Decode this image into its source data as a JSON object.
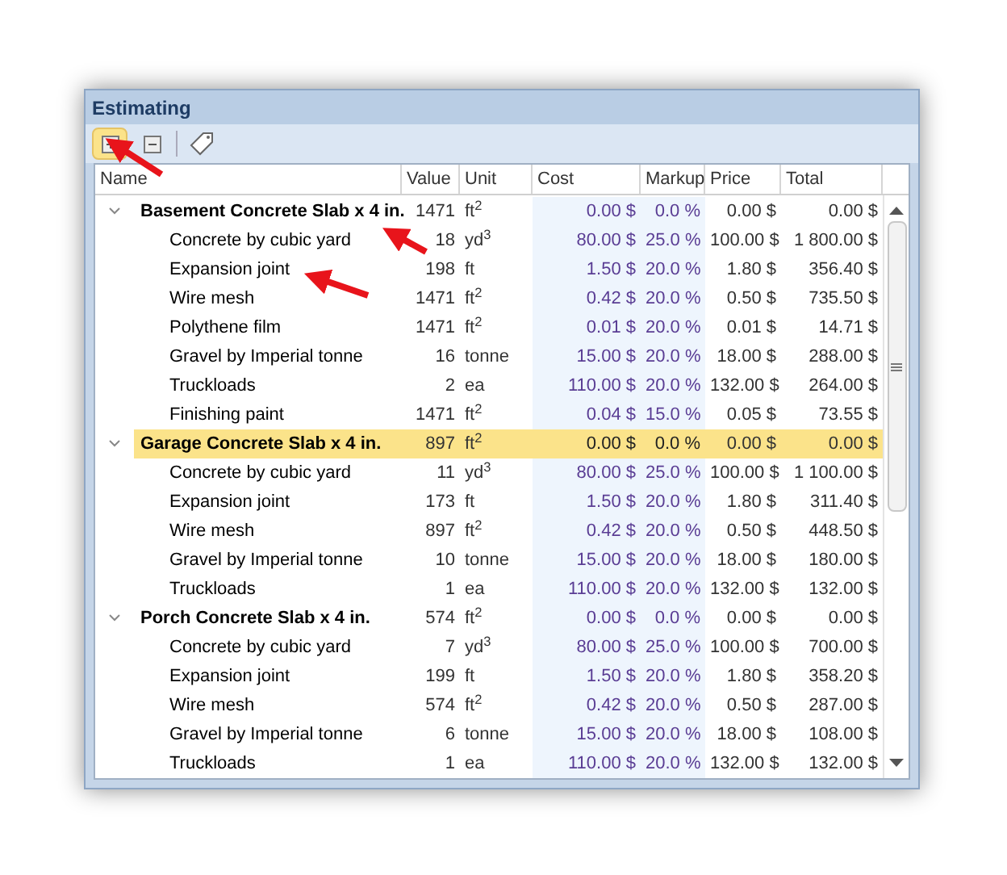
{
  "window": {
    "title": "Estimating"
  },
  "toolbar": [
    {
      "kind": "expand",
      "selected": true
    },
    {
      "kind": "collapse",
      "selected": false
    },
    {
      "kind": "price-tag",
      "selected": false
    }
  ],
  "table": {
    "columns": [
      "Name",
      "Value",
      "Unit",
      "Cost",
      "Markup",
      "Price",
      "Total"
    ],
    "groups": [
      {
        "name": "Basement Concrete Slab x 4 in.",
        "value": "1471",
        "unit": "ft$^{2}$",
        "cost": "0.00 $",
        "markup": "0.0 %",
        "price": "0.00 $",
        "total": "0.00 $",
        "expanded": true,
        "selected": false,
        "children": [
          {
            "name": "Concrete by cubic yard",
            "value": "18",
            "unit": "yd$^{3}$",
            "cost": "80.00 $",
            "markup": "25.0 %",
            "price": "100.00 $",
            "total": "1 800.00 $"
          },
          {
            "name": "Expansion joint",
            "value": "198",
            "unit": "ft",
            "cost": "1.50 $",
            "markup": "20.0 %",
            "price": "1.80 $",
            "total": "356.40 $"
          },
          {
            "name": "Wire mesh",
            "value": "1471",
            "unit": "ft$^{2}$",
            "cost": "0.42 $",
            "markup": "20.0 %",
            "price": "0.50 $",
            "total": "735.50 $"
          },
          {
            "name": "Polythene film",
            "value": "1471",
            "unit": "ft$^{2}$",
            "cost": "0.01 $",
            "markup": "20.0 %",
            "price": "0.01 $",
            "total": "14.71 $"
          },
          {
            "name": "Gravel by Imperial tonne",
            "value": "16",
            "unit": "tonne",
            "cost": "15.00 $",
            "markup": "20.0 %",
            "price": "18.00 $",
            "total": "288.00 $"
          },
          {
            "name": "Truckloads",
            "value": "2",
            "unit": "ea",
            "cost": "110.00 $",
            "markup": "20.0 %",
            "price": "132.00 $",
            "total": "264.00 $"
          },
          {
            "name": "Finishing paint",
            "value": "1471",
            "unit": "ft$^{2}$",
            "cost": "0.04 $",
            "markup": "15.0 %",
            "price": "0.05 $",
            "total": "73.55 $"
          }
        ]
      },
      {
        "name": "Garage Concrete Slab x 4 in.",
        "value": "897",
        "unit": "ft$^{2}$",
        "cost": "0.00 $",
        "markup": "0.0 %",
        "price": "0.00 $",
        "total": "0.00 $",
        "expanded": true,
        "selected": true,
        "children": [
          {
            "name": "Concrete by cubic yard",
            "value": "11",
            "unit": "yd$^{3}$",
            "cost": "80.00 $",
            "markup": "25.0 %",
            "price": "100.00 $",
            "total": "1 100.00 $"
          },
          {
            "name": "Expansion joint",
            "value": "173",
            "unit": "ft",
            "cost": "1.50 $",
            "markup": "20.0 %",
            "price": "1.80 $",
            "total": "311.40 $"
          },
          {
            "name": "Wire mesh",
            "value": "897",
            "unit": "ft$^{2}$",
            "cost": "0.42 $",
            "markup": "20.0 %",
            "price": "0.50 $",
            "total": "448.50 $"
          },
          {
            "name": "Gravel by Imperial tonne",
            "value": "10",
            "unit": "tonne",
            "cost": "15.00 $",
            "markup": "20.0 %",
            "price": "18.00 $",
            "total": "180.00 $"
          },
          {
            "name": "Truckloads",
            "value": "1",
            "unit": "ea",
            "cost": "110.00 $",
            "markup": "20.0 %",
            "price": "132.00 $",
            "total": "132.00 $"
          }
        ]
      },
      {
        "name": "Porch Concrete Slab x 4 in.",
        "value": "574",
        "unit": "ft$^{2}$",
        "cost": "0.00 $",
        "markup": "0.0 %",
        "price": "0.00 $",
        "total": "0.00 $",
        "expanded": true,
        "selected": false,
        "children": [
          {
            "name": "Concrete by cubic yard",
            "value": "7",
            "unit": "yd$^{3}$",
            "cost": "80.00 $",
            "markup": "25.0 %",
            "price": "100.00 $",
            "total": "700.00 $"
          },
          {
            "name": "Expansion joint",
            "value": "199",
            "unit": "ft",
            "cost": "1.50 $",
            "markup": "20.0 %",
            "price": "1.80 $",
            "total": "358.20 $"
          },
          {
            "name": "Wire mesh",
            "value": "574",
            "unit": "ft$^{2}$",
            "cost": "0.42 $",
            "markup": "20.0 %",
            "price": "0.50 $",
            "total": "287.00 $"
          },
          {
            "name": "Gravel by Imperial tonne",
            "value": "6",
            "unit": "tonne",
            "cost": "15.00 $",
            "markup": "20.0 %",
            "price": "18.00 $",
            "total": "108.00 $"
          },
          {
            "name": "Truckloads",
            "value": "1",
            "unit": "ea",
            "cost": "110.00 $",
            "markup": "20.0 %",
            "price": "132.00 $",
            "total": "132.00 $"
          }
        ]
      }
    ]
  }
}
